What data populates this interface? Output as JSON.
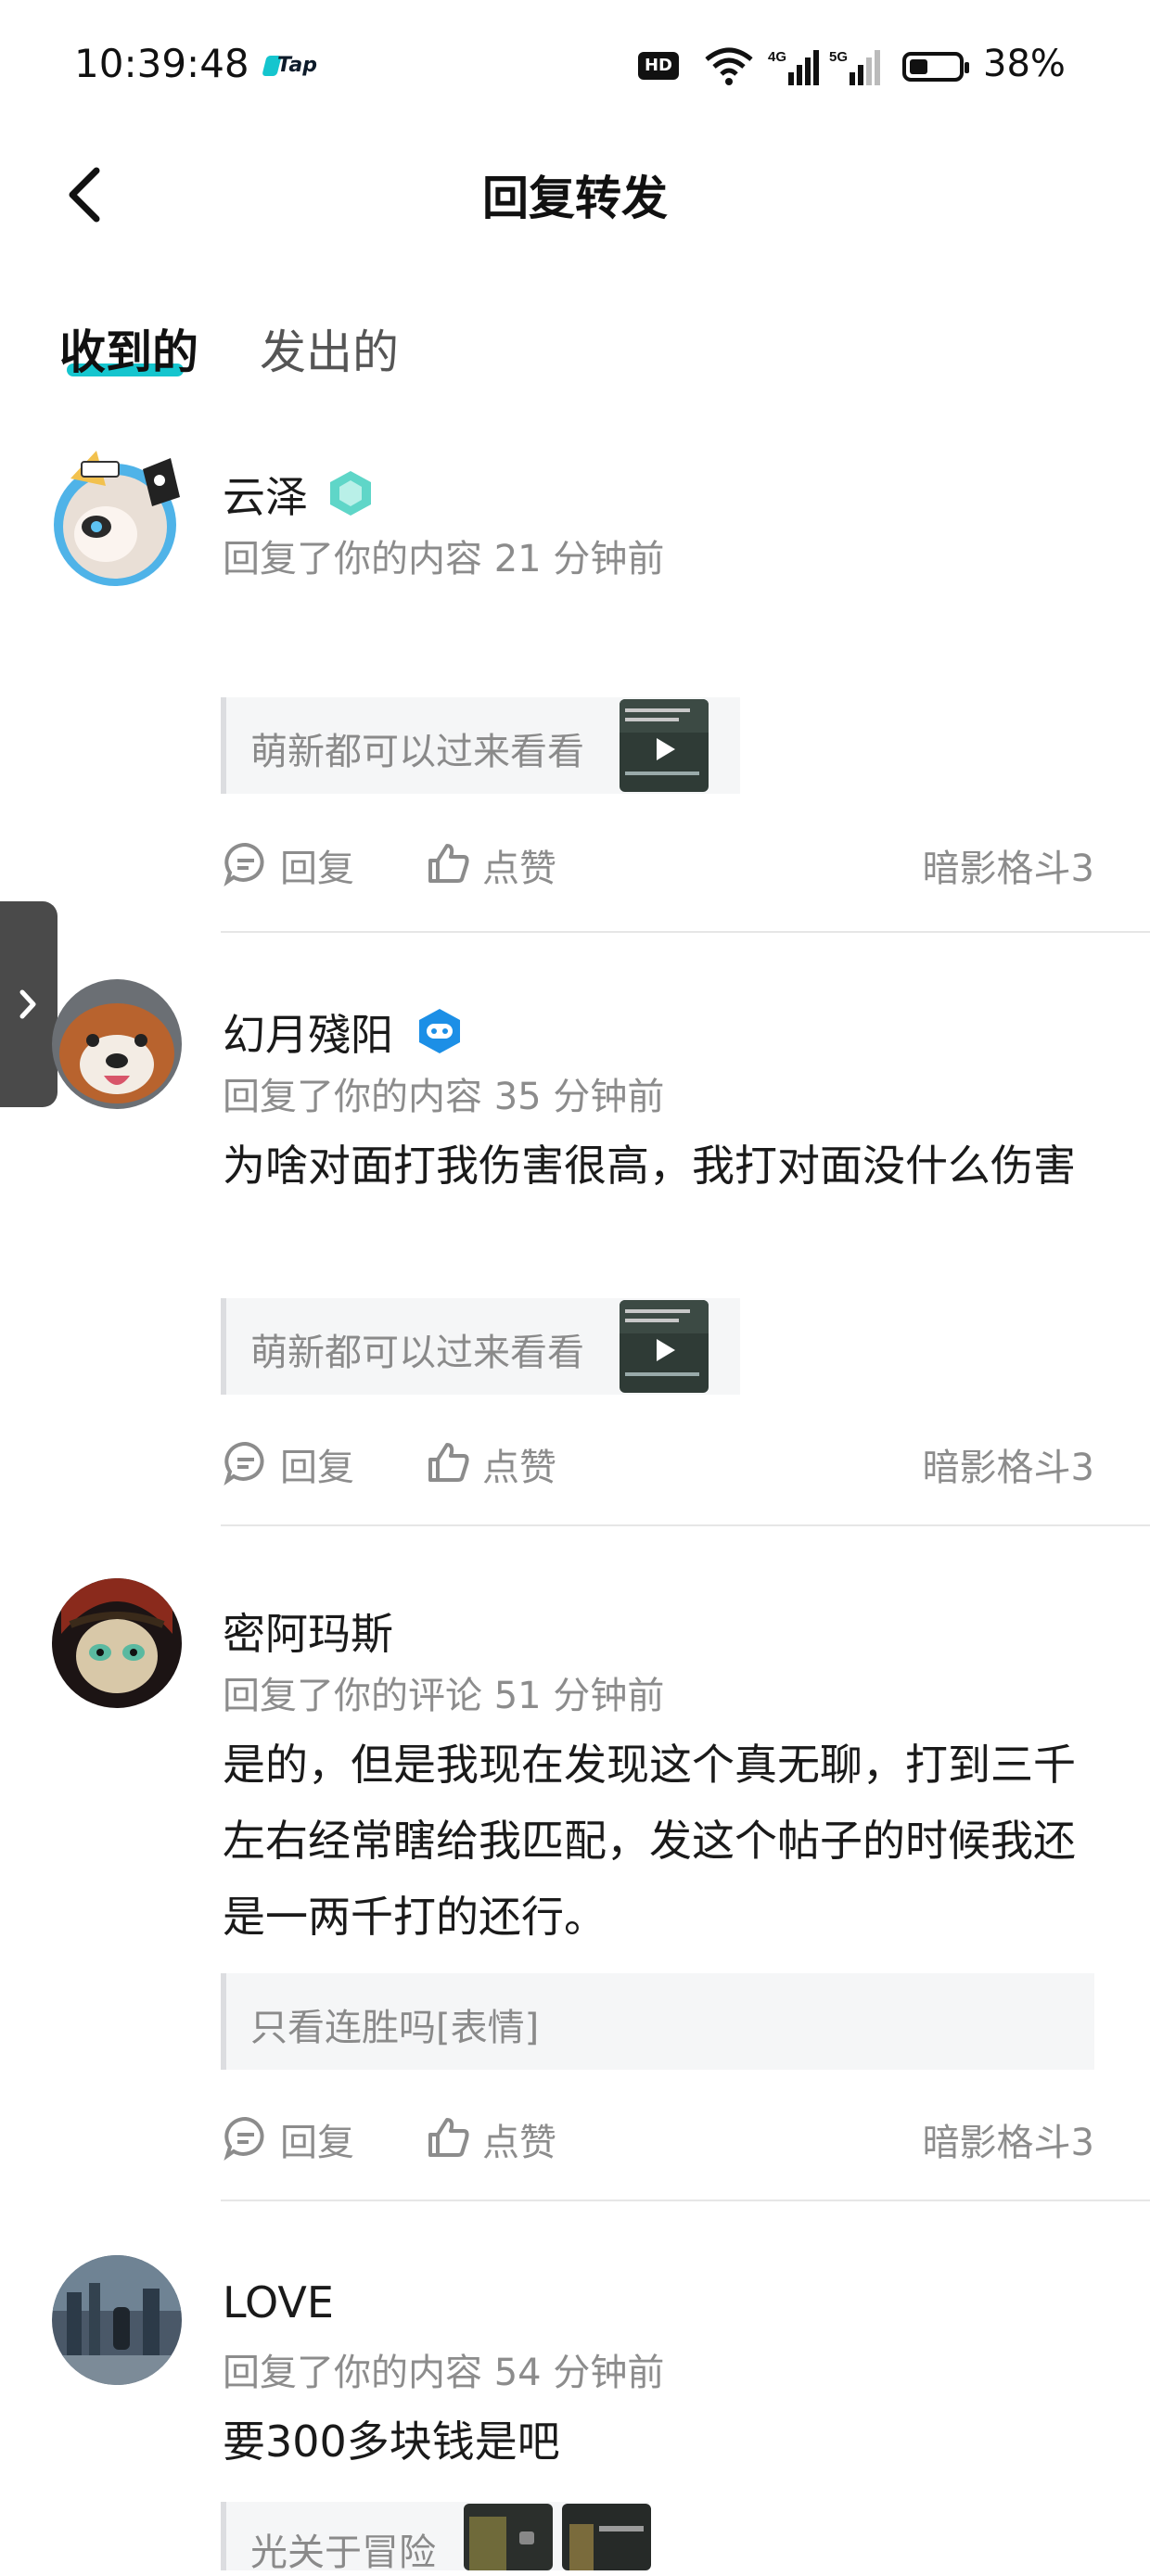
{
  "status_bar": {
    "time": "10:39:48",
    "app_badge": "Tap",
    "network_hd": "HD",
    "net_4g": "4G",
    "net_5g": "5G",
    "battery_percent": "38%",
    "battery_level": 0.38
  },
  "header": {
    "title": "回复转发",
    "back_icon": "chevron-left-icon"
  },
  "tabs": [
    {
      "label": "收到的",
      "active": true
    },
    {
      "label": "发出的",
      "active": false
    }
  ],
  "feed": [
    {
      "user": "云泽",
      "badge_icon": "green-hexagon-badge",
      "meta": "回复了你的内容 21 分钟前",
      "body": "",
      "quote": "萌新都可以过来看看",
      "actions": {
        "reply": "回复",
        "like": "点赞"
      },
      "game": "暗影格斗3"
    },
    {
      "user": "幻月殘阳",
      "badge_icon": "blue-gamepad-badge",
      "meta": "回复了你的内容 35 分钟前",
      "body": "为啥对面打我伤害很高，我打对面没什么伤害",
      "quote": "萌新都可以过来看看",
      "actions": {
        "reply": "回复",
        "like": "点赞"
      },
      "game": "暗影格斗3"
    },
    {
      "user": "密阿玛斯",
      "meta": "回复了你的评论 51 分钟前",
      "body": "是的，但是我现在发现这个真无聊，打到三千左右经常瞎给我匹配，发这个帖子的时候我还是一两千打的还行。",
      "quote": "只看连胜吗[表情]",
      "actions": {
        "reply": "回复",
        "like": "点赞"
      },
      "game": "暗影格斗3"
    },
    {
      "user": "LOVE",
      "meta": "回复了你的内容 54 分钟前",
      "body": "要300多块钱是吧",
      "quote": "光关于冒险"
    }
  ],
  "colors": {
    "accent": "#15c5ce",
    "muted": "#8c8c8c",
    "divider": "#e6e6e6"
  }
}
